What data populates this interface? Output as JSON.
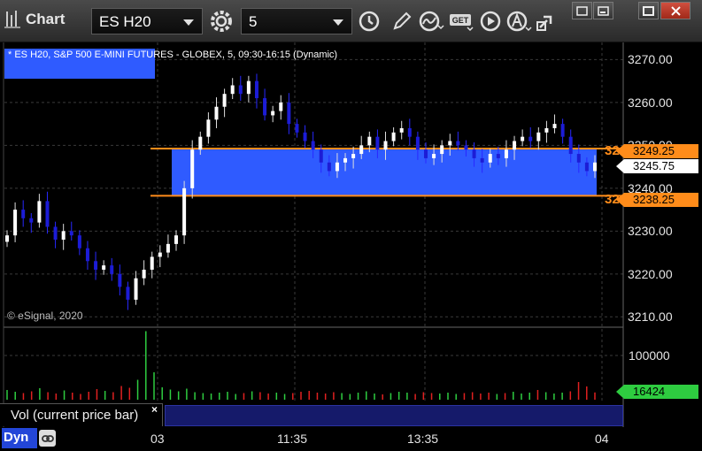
{
  "app": {
    "title": "Chart"
  },
  "toolbar": {
    "symbol": "ES H20",
    "interval": "5",
    "icons": [
      "settings-gear-icon",
      "clock-icon",
      "pencil-draw-icon",
      "study-wave-icon",
      "get-data-icon",
      "play-icon",
      "alert-icon",
      "link-arrow-icon"
    ]
  },
  "window_controls": [
    "restore-icon",
    "minimize-icon",
    "maximize-icon",
    "close-icon"
  ],
  "legend": {
    "text": "* ES H20, S&P 500 E-MINI FUTURES - GLOBEX, 5, 09:30-16:15 (Dynamic)"
  },
  "watermark": "© eSignal, 2020",
  "price_tags": {
    "upper_line": "3249.25",
    "current": "3245.75",
    "lower_line": "3238.25",
    "volume": "16424",
    "edge_upper": "32",
    "edge_lower": "32"
  },
  "study_panel": {
    "label": "Vol (current price bar)",
    "close": "×"
  },
  "footer": {
    "mode": "Dyn"
  },
  "colors": {
    "zone": "#2f5bff",
    "level_line": "#ff8c1a",
    "candle_up": "#ffffff",
    "candle_down": "#1c1cd6",
    "volume_up": "#2ecc40",
    "volume_down": "#e02020",
    "volume_tag": "#2ecc40"
  },
  "chart_data": {
    "type": "candlestick",
    "title": "",
    "price_axis": {
      "ylim": [
        3208,
        3274
      ],
      "ticks": [
        3210,
        3220,
        3230,
        3240,
        3250,
        3260,
        3270
      ],
      "tick_labels": [
        "3210.00",
        "3220.00",
        "3230.00",
        "3240.00",
        "3250.00",
        "3260.00",
        "3270.00"
      ]
    },
    "volume_axis": {
      "ylim": [
        0,
        160000
      ],
      "ticks": [
        100000
      ],
      "tick_labels": [
        "100000"
      ]
    },
    "x_axis": {
      "tick_labels": [
        "03",
        "11:35",
        "13:35",
        "04"
      ]
    },
    "levels": [
      {
        "name": "upper",
        "price": 3249.25
      },
      {
        "name": "lower",
        "price": 3238.25
      }
    ],
    "last_price": 3245.75,
    "last_volume": 16424,
    "close_series": [
      3229,
      3235,
      3233,
      3232,
      3237,
      3231,
      3228,
      3230,
      3229,
      3226,
      3223,
      3221,
      3222,
      3220,
      3217,
      3214,
      3219,
      3221,
      3224,
      3225,
      3227,
      3229,
      3240,
      3249,
      3252,
      3256,
      3259,
      3262,
      3264,
      3262,
      3265,
      3261,
      3257,
      3258,
      3260,
      3255,
      3253,
      3251,
      3249,
      3246,
      3244,
      3246,
      3247,
      3248,
      3250,
      3252,
      3249,
      3251,
      3253,
      3254,
      3252,
      3249,
      3247,
      3248,
      3250,
      3251,
      3250,
      3249,
      3247,
      3246,
      3248,
      3247,
      3249,
      3251,
      3252,
      3251,
      3253,
      3254,
      3255,
      3252,
      3248,
      3246,
      3244,
      3246
    ],
    "volume_series": [
      22000,
      18000,
      15000,
      19000,
      26000,
      17000,
      14000,
      21000,
      16000,
      13000,
      18000,
      24000,
      20000,
      17000,
      31000,
      27000,
      45000,
      155000,
      62000,
      28000,
      23000,
      19000,
      25000,
      17000,
      15000,
      14000,
      16000,
      18000,
      13000,
      15000,
      19000,
      17000,
      14000,
      16000,
      13000,
      15000,
      18000,
      20000,
      16000,
      14000,
      17000,
      15000,
      13000,
      16000,
      19000,
      14000,
      12000,
      15000,
      18000,
      16000,
      13000,
      17000,
      15000,
      14000,
      16000,
      13000,
      15000,
      17000,
      14000,
      16000,
      13000,
      15000,
      18000,
      14000,
      16000,
      22000,
      17000,
      14000,
      16000,
      19000,
      40000,
      30000,
      16424
    ]
  }
}
